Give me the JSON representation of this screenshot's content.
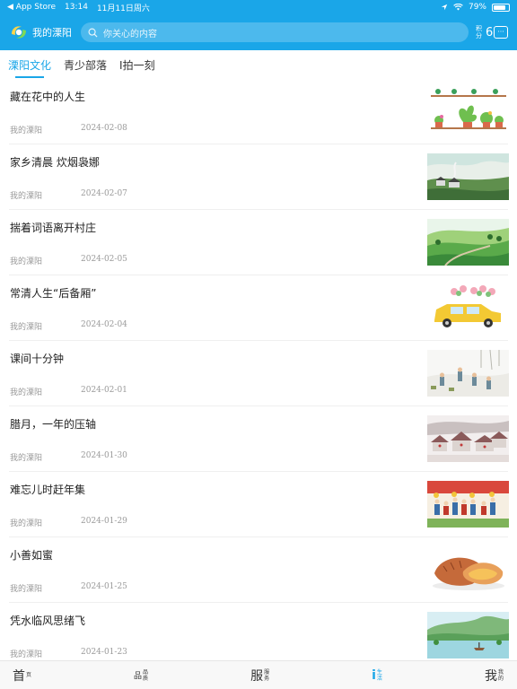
{
  "status_bar": {
    "back_app": "◀ App Store",
    "time": "13:14",
    "date": "11月11日周六",
    "battery": "79%",
    "battery_level": 0.79
  },
  "header": {
    "app_title": "我的溧阳",
    "search_placeholder": "你关心的内容",
    "points_label": "积分",
    "points_value": "6"
  },
  "tabs": [
    {
      "label": "溧阳文化",
      "active": true
    },
    {
      "label": "青少部落",
      "active": false
    },
    {
      "label": "I拍一刻",
      "active": false
    }
  ],
  "articles": [
    {
      "title": "藏在花中的人生",
      "source": "我的溧阳",
      "date": "2024-02-08",
      "image": "potted-plants-illustration"
    },
    {
      "title": "家乡清晨 炊烟袅娜",
      "source": "我的溧阳",
      "date": "2024-02-07",
      "image": "morning-village-illustration"
    },
    {
      "title": "揣着词语离开村庄",
      "source": "我的溧阳",
      "date": "2024-02-05",
      "image": "green-hills-illustration"
    },
    {
      "title": "常清人生“后备厢”",
      "source": "我的溧阳",
      "date": "2024-02-04",
      "image": "yellow-car-illustration"
    },
    {
      "title": "课间十分钟",
      "source": "我的溧阳",
      "date": "2024-02-01",
      "image": "snow-children-illustration"
    },
    {
      "title": "腊月，一年的压轴",
      "source": "我的溧阳",
      "date": "2024-01-30",
      "image": "village-rooftops-illustration"
    },
    {
      "title": "难忘儿时赶年集",
      "source": "我的溧阳",
      "date": "2024-01-29",
      "image": "new-year-market-illustration"
    },
    {
      "title": "小善如蜜",
      "source": "我的溧阳",
      "date": "2024-01-25",
      "image": "sweet-potato-illustration"
    },
    {
      "title": "凭水临风思绪飞",
      "source": "我的溧阳",
      "date": "2024-01-23",
      "image": "lake-boat-illustration"
    }
  ],
  "tabbar": [
    {
      "big": "首",
      "small": "页",
      "active": false
    },
    {
      "big": "品",
      "small": "品质",
      "active": false
    },
    {
      "big": "服",
      "small": "服务",
      "active": false
    },
    {
      "big": "i",
      "small": "生活",
      "active": true
    },
    {
      "big": "我",
      "small": "我的",
      "active": false
    }
  ],
  "colors": {
    "accent": "#1aa6e8"
  }
}
